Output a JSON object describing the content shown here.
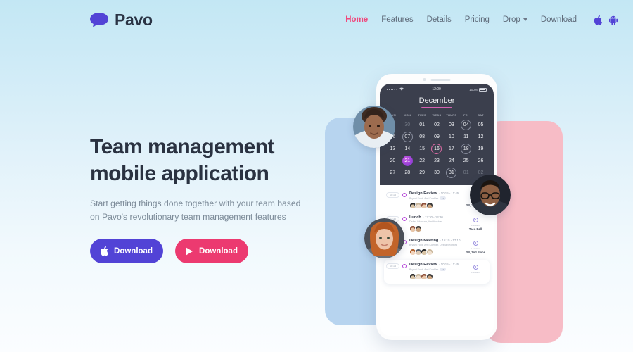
{
  "brand": {
    "name": "Pavo",
    "logo_icon": "speech-bubble-icon",
    "logo_color": "#5243d6"
  },
  "nav": {
    "items": [
      {
        "label": "Home",
        "active": true
      },
      {
        "label": "Features",
        "active": false
      },
      {
        "label": "Details",
        "active": false
      },
      {
        "label": "Pricing",
        "active": false
      },
      {
        "label": "Drop",
        "active": false,
        "has_caret": true
      },
      {
        "label": "Download",
        "active": false
      }
    ],
    "icons": [
      {
        "name": "apple-icon",
        "color": "#5243d6"
      },
      {
        "name": "android-icon",
        "color": "#5243d6"
      }
    ],
    "active_color": "#f0487c",
    "link_color": "#5f6b7a"
  },
  "hero": {
    "title_line1": "Team management",
    "title_line2": "mobile application",
    "subtitle_line1": "Start getting things done together with your team based",
    "subtitle_line2": "on Pavo's revolutionary team management features",
    "buttons": [
      {
        "label": "Download",
        "icon": "apple-icon",
        "color": "#5243d6"
      },
      {
        "label": "Download",
        "icon": "play-triangle-icon",
        "color": "#ec3a70"
      }
    ]
  },
  "phone": {
    "statusbar": {
      "time": "12:00",
      "battery": "100%",
      "signal_icon": "signal-dots-icon",
      "wifi_icon": "wifi-icon"
    },
    "calendar": {
      "month": "December",
      "day_labels": [
        "SUN",
        "MON",
        "TUES",
        "WEDS",
        "THURS",
        "FRI",
        "SAT"
      ],
      "weeks": [
        [
          {
            "d": "29",
            "s": "muted"
          },
          {
            "d": "30",
            "s": "muted"
          },
          {
            "d": "01",
            "s": ""
          },
          {
            "d": "02",
            "s": ""
          },
          {
            "d": "03",
            "s": ""
          },
          {
            "d": "04",
            "s": "ring"
          },
          {
            "d": "05",
            "s": ""
          }
        ],
        [
          {
            "d": "06",
            "s": ""
          },
          {
            "d": "07",
            "s": "ring"
          },
          {
            "d": "08",
            "s": ""
          },
          {
            "d": "09",
            "s": ""
          },
          {
            "d": "10",
            "s": ""
          },
          {
            "d": "11",
            "s": ""
          },
          {
            "d": "12",
            "s": ""
          }
        ],
        [
          {
            "d": "13",
            "s": ""
          },
          {
            "d": "14",
            "s": ""
          },
          {
            "d": "15",
            "s": ""
          },
          {
            "d": "16",
            "s": "ring-pink"
          },
          {
            "d": "17",
            "s": ""
          },
          {
            "d": "18",
            "s": "ring"
          },
          {
            "d": "19",
            "s": ""
          }
        ],
        [
          {
            "d": "20",
            "s": ""
          },
          {
            "d": "21",
            "s": "sel"
          },
          {
            "d": "22",
            "s": ""
          },
          {
            "d": "23",
            "s": ""
          },
          {
            "d": "24",
            "s": ""
          },
          {
            "d": "25",
            "s": ""
          },
          {
            "d": "26",
            "s": ""
          }
        ],
        [
          {
            "d": "27",
            "s": ""
          },
          {
            "d": "28",
            "s": ""
          },
          {
            "d": "29",
            "s": ""
          },
          {
            "d": "30",
            "s": ""
          },
          {
            "d": "31",
            "s": "ring"
          },
          {
            "d": "01",
            "s": "muted"
          },
          {
            "d": "02",
            "s": "muted"
          }
        ]
      ],
      "selected_day": "21",
      "accent_underline_color": "#d35fb0"
    },
    "events": [
      {
        "time_pill": "10:15",
        "title": "Design Review",
        "time_range": "10:15 - 11:45",
        "people": "Bryant Ford, Ami Koehler",
        "extra_count": "+2",
        "location_label": "Location",
        "location_value": "3B, 2nd Floor",
        "avatar_count": 4,
        "card": false
      },
      {
        "time_pill": "12:30",
        "title": "Lunch",
        "time_range": "12:30 - 13:30",
        "people": "Debra Womura, Ami Koehler",
        "extra_count": "",
        "location_label": "Location",
        "location_value": "Taco Bell",
        "avatar_count": 2,
        "card": false
      },
      {
        "time_pill": "16:15",
        "title": "Design Meeting",
        "time_range": "16:15 - 17:10",
        "people": "Bryant Ford, Ami Koehler, Debra Womura",
        "extra_count": "",
        "location_label": "Location",
        "location_value": "3B, 2nd Floor",
        "avatar_count": 4,
        "card": false
      },
      {
        "time_pill": "10:15",
        "title": "Design Review",
        "time_range": "10:15 - 11:45",
        "people": "Bryant Ford, Ami Koehler",
        "extra_count": "+2",
        "location_label": "Location",
        "location_value": "",
        "avatar_count": 4,
        "card": true
      }
    ]
  },
  "decor": {
    "blue_shape_color": "#b7d4ef",
    "pink_shape_color": "#f7bcc6",
    "avatars": [
      {
        "name": "avatar-woman-curly",
        "position": "top-left"
      },
      {
        "name": "avatar-man-glasses",
        "position": "right"
      },
      {
        "name": "avatar-woman-redhair",
        "position": "bottom-left"
      }
    ]
  }
}
